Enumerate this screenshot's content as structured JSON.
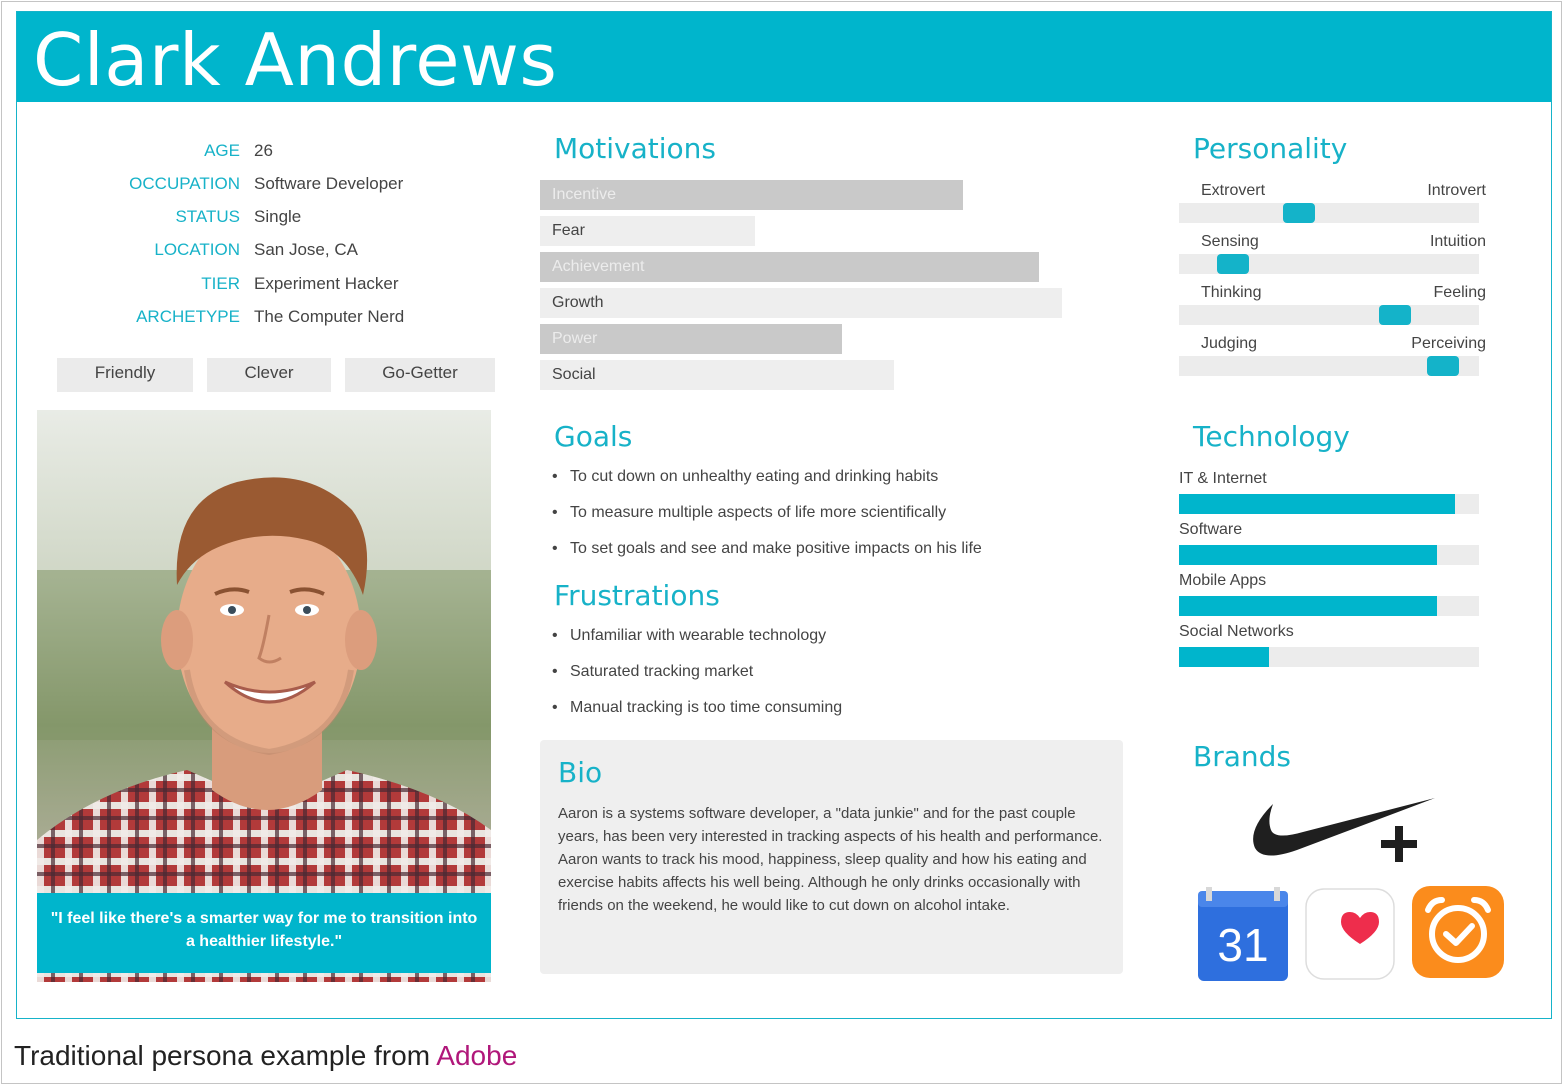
{
  "persona": {
    "name": "Clark Andrews",
    "profile": [
      {
        "label": "AGE",
        "value": "26"
      },
      {
        "label": "OCCUPATION",
        "value": "Software Developer"
      },
      {
        "label": "STATUS",
        "value": "Single"
      },
      {
        "label": "LOCATION",
        "value": "San Jose, CA"
      },
      {
        "label": "TIER",
        "value": "Experiment Hacker"
      },
      {
        "label": "ARCHETYPE",
        "value": "The Computer Nerd"
      }
    ],
    "traits": [
      "Friendly",
      "Clever",
      "Go-Getter"
    ],
    "quote": "\"I feel like there's a smarter way for me to transition into a healthier lifestyle.\"",
    "motivations_title": "Motivations",
    "motivations": [
      {
        "label": "Incentive",
        "level": 0.73,
        "style": "dark"
      },
      {
        "label": "Fear",
        "level": 0.37,
        "style": "light"
      },
      {
        "label": "Achievement",
        "level": 0.86,
        "style": "dark"
      },
      {
        "label": "Growth",
        "level": 0.9,
        "style": "light"
      },
      {
        "label": "Power",
        "level": 0.52,
        "style": "dark"
      },
      {
        "label": "Social",
        "level": 0.61,
        "style": "light"
      }
    ],
    "goals_title": "Goals",
    "goals": [
      "To cut down on unhealthy eating and drinking habits",
      "To measure multiple aspects of life more scientifically",
      "To set goals and see and make positive impacts on his life"
    ],
    "frustrations_title": "Frustrations",
    "frustrations": [
      "Unfamiliar with wearable technology",
      "Saturated tracking market",
      "Manual tracking is too time consuming"
    ],
    "bio_title": "Bio",
    "bio_text": "Aaron is a systems software developer, a \"data junkie\" and for the past couple years, has been very interested in tracking aspects of his health and performance. Aaron wants to track his mood, happiness, sleep quality and how his eating and exercise habits affects his well being. Although he only drinks occasionally with friends on the weekend, he would like to cut down on alcohol intake.",
    "personality_title": "Personality",
    "personality": [
      {
        "left": "Extrovert",
        "right": "Introvert",
        "position": 0.4
      },
      {
        "left": "Sensing",
        "right": "Intuition",
        "position": 0.18
      },
      {
        "left": "Thinking",
        "right": "Feeling",
        "position": 0.72
      },
      {
        "left": "Judging",
        "right": "Perceiving",
        "position": 0.88
      }
    ],
    "technology_title": "Technology",
    "technology": [
      {
        "label": "IT & Internet",
        "level": 0.92
      },
      {
        "label": "Software",
        "level": 0.86
      },
      {
        "label": "Mobile Apps",
        "level": 0.86
      },
      {
        "label": "Social Networks",
        "level": 0.3
      }
    ],
    "brands_title": "Brands",
    "brands": [
      {
        "icon": "nike-plus-icon"
      },
      {
        "icon": "calendar-icon",
        "text": "31"
      },
      {
        "icon": "health-heart-icon"
      },
      {
        "icon": "alarm-clock-icon"
      }
    ]
  },
  "caption": {
    "text": "Traditional persona example from ",
    "link": "Adobe"
  },
  "colors": {
    "accent": "#00b5cc",
    "link": "#b0177a"
  }
}
